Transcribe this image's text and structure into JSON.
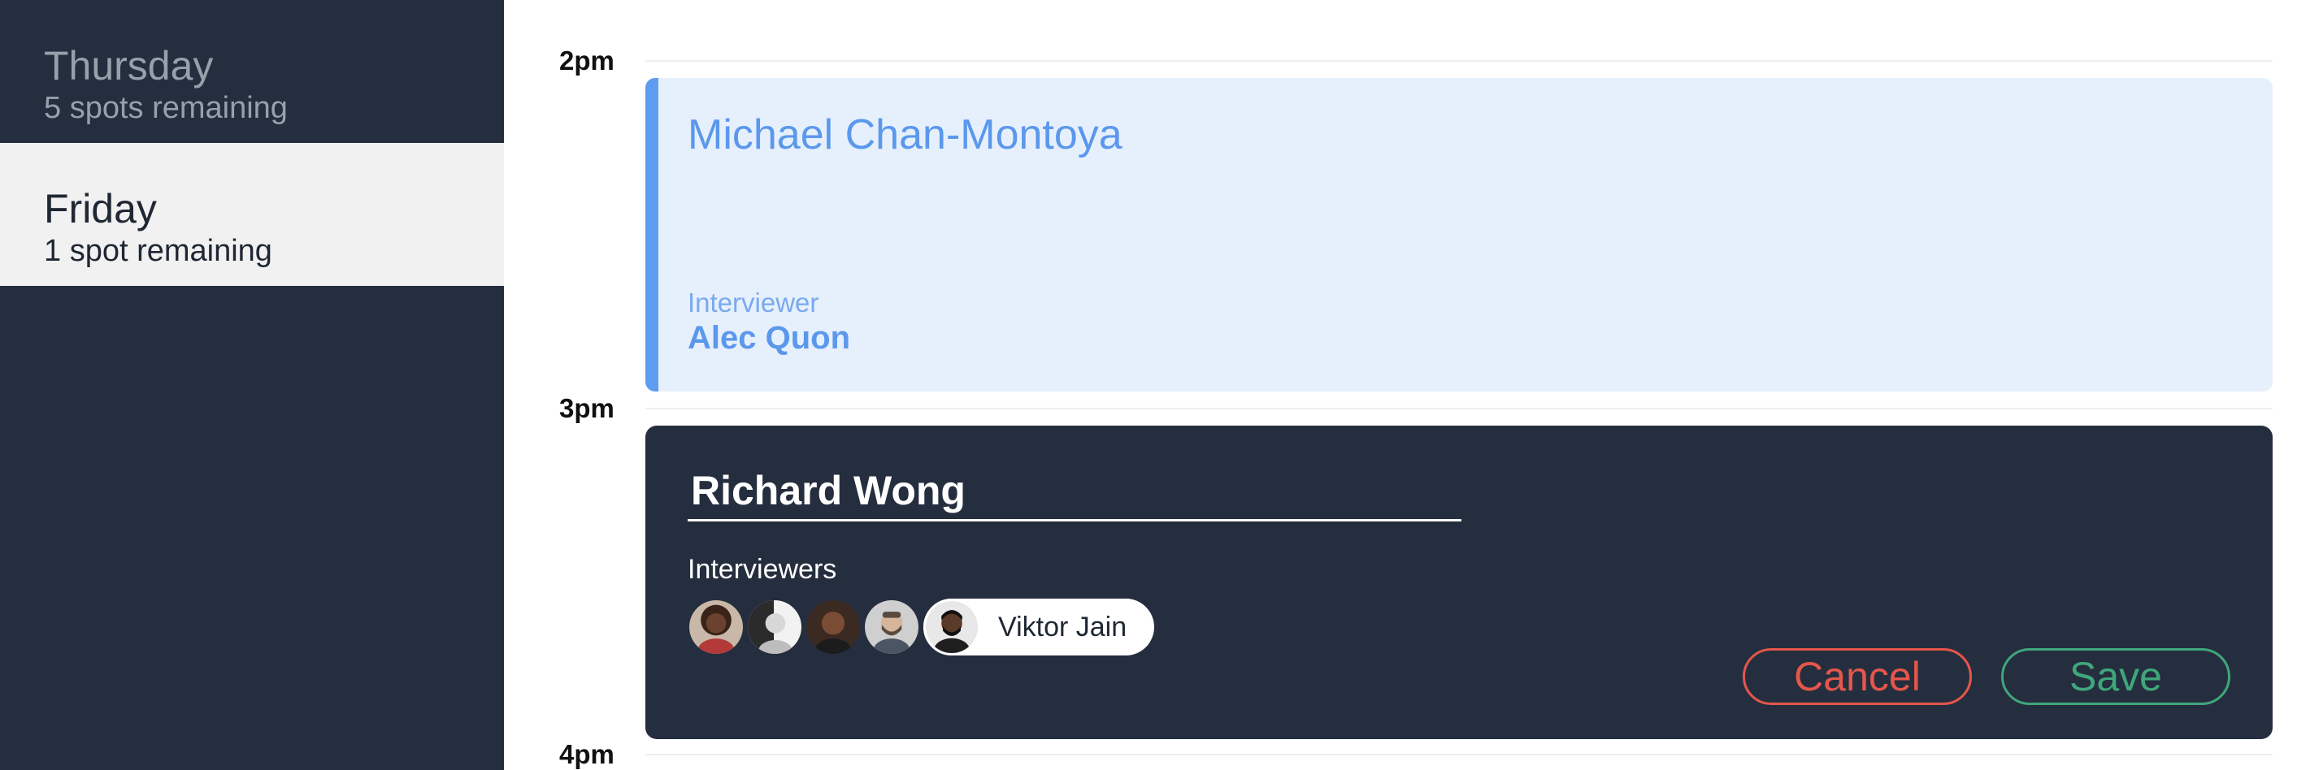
{
  "sidebar": {
    "days": [
      {
        "name": "Thursday",
        "spots": "5 spots remaining",
        "state": "inactive"
      },
      {
        "name": "Friday",
        "spots": "1 spot remaining",
        "state": "active"
      }
    ]
  },
  "timeline": {
    "hours": [
      "2pm",
      "3pm",
      "4pm"
    ]
  },
  "event": {
    "candidate": "Michael Chan-Montoya",
    "role_label": "Interviewer",
    "interviewer": "Alec Quon"
  },
  "editor": {
    "name_value": "Richard Wong",
    "interviewers_label": "Interviewers",
    "avatars": [
      "avatar-woman-curly-hair",
      "avatar-woman-bw",
      "avatar-man-bald",
      "avatar-man-beard",
      "avatar-viktor-jain"
    ],
    "selected_interviewer": "Viktor Jain",
    "cancel_label": "Cancel",
    "save_label": "Save"
  },
  "colors": {
    "sidebar_bg": "#252e3e",
    "accent_blue": "#5b98ec",
    "card_light_bg": "#e6f0fd",
    "cancel_red": "#e5564b",
    "save_green": "#3fa77b"
  }
}
